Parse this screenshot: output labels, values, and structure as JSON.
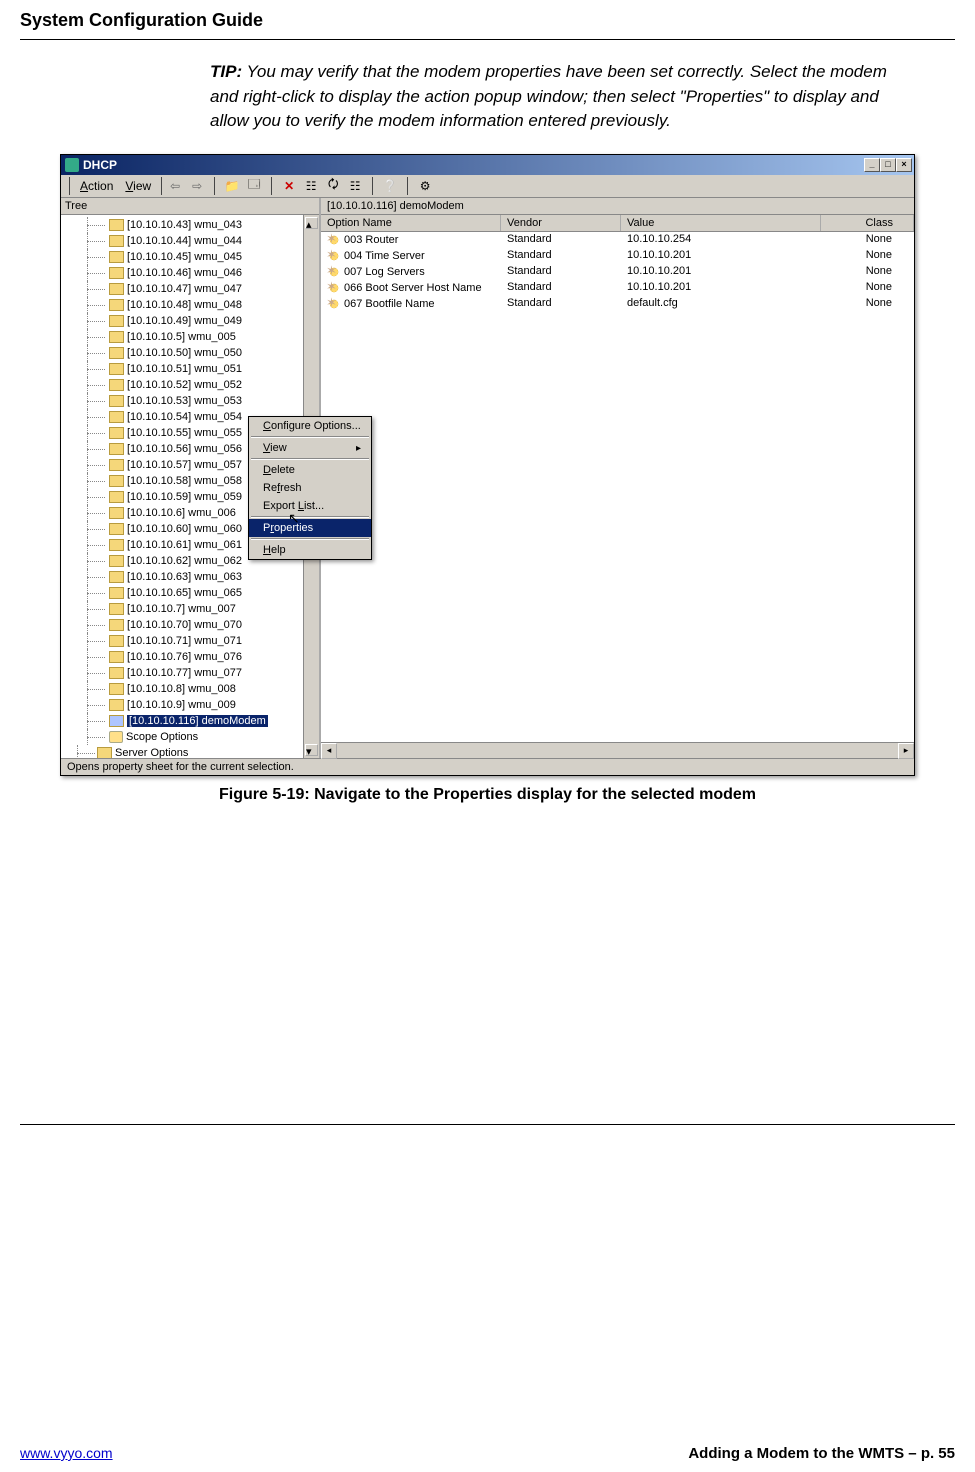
{
  "page": {
    "header": "System Configuration Guide",
    "tip_label": "TIP:",
    "tip_text": " You may verify that the modem properties have been set correctly.  Select the modem and right-click to display the action popup window; then select \"Properties\" to display and allow you to verify the modem information entered previously.",
    "figure_caption": "Figure 5-19: Navigate to the Properties display for the selected modem",
    "footer_left": "www.vyyo.com",
    "footer_right": "Adding a Modem to the WMTS – p. 55"
  },
  "window": {
    "title": "DHCP",
    "menus": {
      "action": "Action",
      "view": "View"
    },
    "tree_header": "Tree",
    "details_header": "[10.10.10.116] demoModem",
    "statusbar": "Opens property sheet for the current selection.",
    "tree_items": [
      "[10.10.10.43] wmu_043",
      "[10.10.10.44] wmu_044",
      "[10.10.10.45] wmu_045",
      "[10.10.10.46] wmu_046",
      "[10.10.10.47] wmu_047",
      "[10.10.10.48] wmu_048",
      "[10.10.10.49] wmu_049",
      "[10.10.10.5] wmu_005",
      "[10.10.10.50] wmu_050",
      "[10.10.10.51] wmu_051",
      "[10.10.10.52] wmu_052",
      "[10.10.10.53] wmu_053",
      "[10.10.10.54] wmu_054",
      "[10.10.10.55] wmu_055",
      "[10.10.10.56] wmu_056",
      "[10.10.10.57] wmu_057",
      "[10.10.10.58] wmu_058",
      "[10.10.10.59] wmu_059",
      "[10.10.10.6] wmu_006",
      "[10.10.10.60] wmu_060",
      "[10.10.10.61] wmu_061",
      "[10.10.10.62] wmu_062",
      "[10.10.10.63] wmu_063",
      "[10.10.10.65] wmu_065",
      "[10.10.10.7] wmu_007",
      "[10.10.10.70] wmu_070",
      "[10.10.10.71] wmu_071",
      "[10.10.10.76] wmu_076",
      "[10.10.10.77] wmu_077",
      "[10.10.10.8] wmu_008",
      "[10.10.10.9] wmu_009"
    ],
    "tree_selected": "[10.10.10.116] demoModem",
    "tree_extra": {
      "scope_options": "Scope Options",
      "server_options": "Server Options"
    },
    "columns": {
      "name": "Option Name",
      "vendor": "Vendor",
      "value": "Value",
      "klass": "Class"
    },
    "rows": [
      {
        "name": "003 Router",
        "vendor": "Standard",
        "value": "10.10.10.254",
        "klass": "None"
      },
      {
        "name": "004 Time Server",
        "vendor": "Standard",
        "value": "10.10.10.201",
        "klass": "None"
      },
      {
        "name": "007 Log Servers",
        "vendor": "Standard",
        "value": "10.10.10.201",
        "klass": "None"
      },
      {
        "name": "066 Boot Server Host Name",
        "vendor": "Standard",
        "value": "10.10.10.201",
        "klass": "None"
      },
      {
        "name": "067 Bootfile Name",
        "vendor": "Standard",
        "value": "default.cfg",
        "klass": "None"
      }
    ],
    "context_menu": {
      "configure": "Configure Options...",
      "view": "View",
      "delete": "Delete",
      "refresh": "Refresh",
      "export": "Export List...",
      "properties": "Properties",
      "help": "Help"
    }
  }
}
